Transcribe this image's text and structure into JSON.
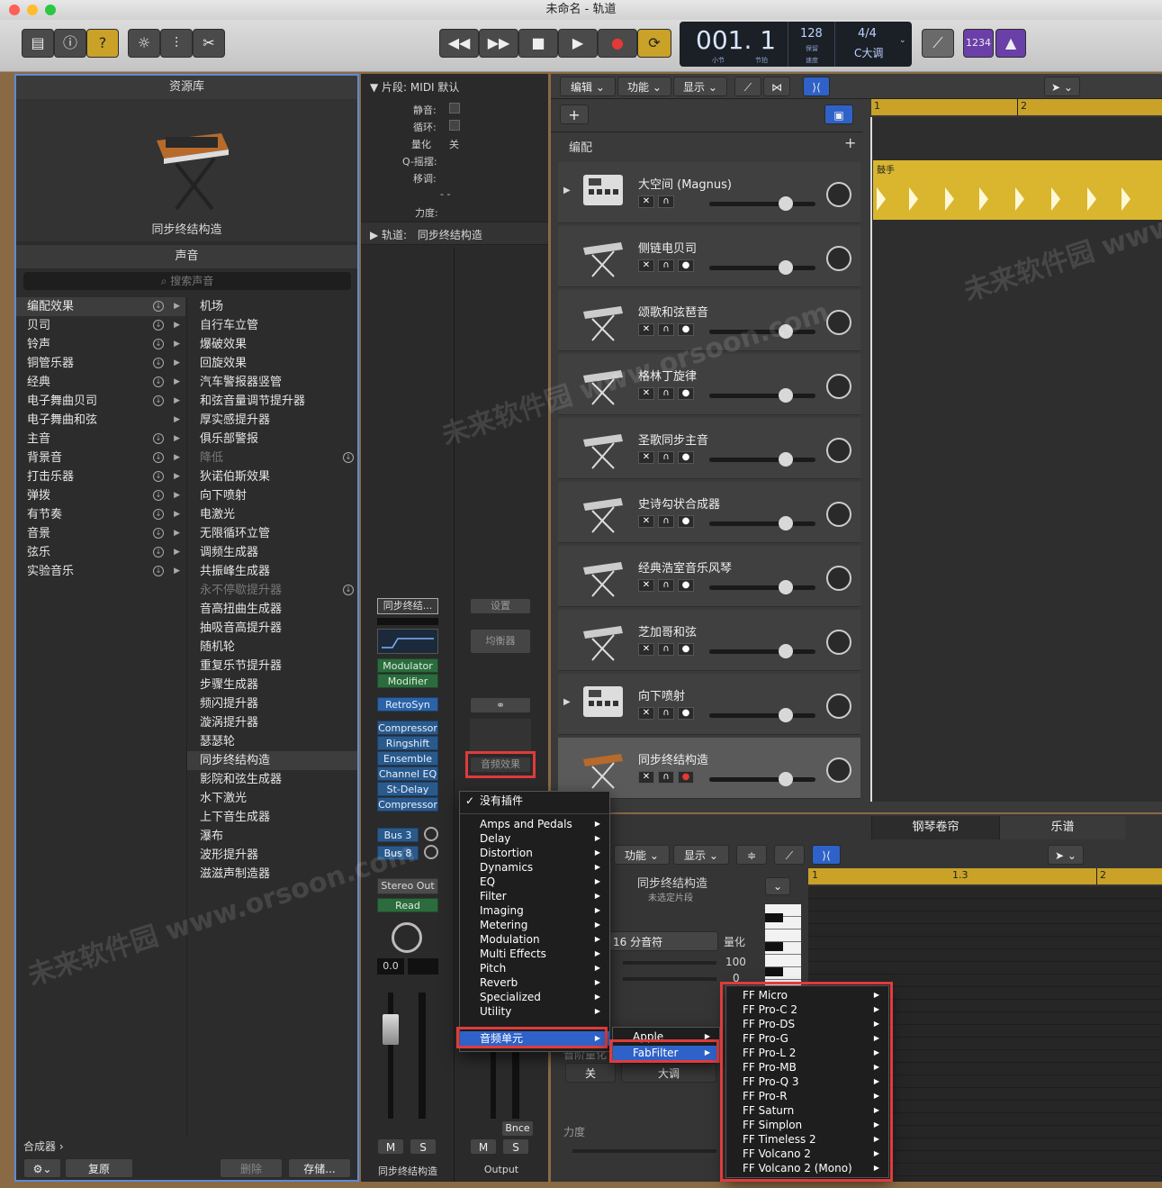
{
  "window": {
    "title": "未命名 - 轨道"
  },
  "toolbar": {
    "buttons": [
      "inbox-icon",
      "info-icon",
      "help-icon",
      "smart-controls-icon",
      "mixer-icon",
      "scissors-icon"
    ],
    "transport": [
      "rewind-icon",
      "forward-icon",
      "stop-icon",
      "play-icon",
      "record-icon",
      "cycle-icon"
    ],
    "lcd": {
      "position": "001. 1",
      "bar_label": "小节",
      "beat_label": "节拍",
      "tempo": "128",
      "tempo_sub": "保留",
      "tempo_label": "速度",
      "signature": "4/4",
      "key": "C大调"
    },
    "count_in": "1234"
  },
  "library": {
    "title": "资源库",
    "patch_name": "同步终结构造",
    "sound_header": "声音",
    "search_placeholder": "搜索声音",
    "categories": [
      "编配效果",
      "贝司",
      "铃声",
      "铜管乐器",
      "经典",
      "电子舞曲贝司",
      "电子舞曲和弦",
      "主音",
      "背景音",
      "打击乐器",
      "弹拨",
      "有节奏",
      "音景",
      "弦乐",
      "实验音乐"
    ],
    "patches": [
      "机场",
      "自行车立管",
      "爆破效果",
      "回旋效果",
      "汽车警报器竖管",
      "和弦音量调节提升器",
      "厚实感提升器",
      "俱乐部警报",
      "降低",
      "狄诺伯斯效果",
      "向下喷射",
      "电激光",
      "无限循环立管",
      "调频生成器",
      "共振峰生成器",
      "永不停歇提升器",
      "音高扭曲生成器",
      "抽吸音高提升器",
      "随机轮",
      "重复乐节提升器",
      "步骤生成器",
      "频闪提升器",
      "漩涡提升器",
      "瑟瑟轮",
      "同步终结构造",
      "影院和弦生成器",
      "水下激光",
      "上下音生成器",
      "瀑布",
      "波形提升器",
      "滋滋声制造器"
    ],
    "footer": {
      "synth_label": "合成器",
      "revert": "复原",
      "delete": "删除",
      "save": "存储..."
    }
  },
  "inspector": {
    "region_header": "片段:",
    "region_name": "MIDI 默认",
    "fields": {
      "mute": "静音:",
      "loop": "循环:",
      "quantize": "量化",
      "quantize_value": "关",
      "qswing": "Q-摇摆:",
      "transpose": "移调:",
      "dashes": "- -",
      "velocity": "力度:"
    },
    "track_header": "轨道:",
    "track_name": "同步终结构造",
    "channel": {
      "name_btn": "同步终结...",
      "settings": "设置",
      "eq": "均衡器",
      "midi_fx": [
        "Modulator",
        "Modifier"
      ],
      "instrument": "RetroSyn",
      "audio_fx": [
        "Compressor",
        "Ringshift",
        "Ensemble",
        "Channel EQ",
        "St-Delay",
        "Compressor"
      ],
      "audio_fx_slot": "音频效果",
      "sends": [
        "Bus 3",
        "Bus 8"
      ],
      "output": "Stereo Out",
      "automation": "Read",
      "volume": "0.0",
      "mute": "M",
      "solo": "S",
      "strip_name": "同步终结构造",
      "bounce": "Bnce",
      "output_name": "Output"
    }
  },
  "tracks_toolbar": {
    "edit": "编辑",
    "functions": "功能",
    "view": "显示",
    "arrangement": "编配"
  },
  "tracks": [
    {
      "name": "大空间 (Magnus)",
      "fader": 0.72
    },
    {
      "name": "侧链电贝司",
      "fader": 0.72
    },
    {
      "name": "颂歌和弦琶音",
      "fader": 0.72
    },
    {
      "name": "格林丁旋律",
      "fader": 0.72
    },
    {
      "name": "圣歌同步主音",
      "fader": 0.72
    },
    {
      "name": "史诗勾状合成器",
      "fader": 0.72
    },
    {
      "name": "经典浩室音乐风琴",
      "fader": 0.72
    },
    {
      "name": "芝加哥和弦",
      "fader": 0.72
    },
    {
      "name": "向下喷射",
      "fader": 0.72
    },
    {
      "name": "同步终结构造",
      "fader": 0.72
    }
  ],
  "ruler": {
    "bar1": "1",
    "bar2": "2"
  },
  "region": {
    "name": "鼓手"
  },
  "editor": {
    "tabs": [
      "钢琴卷帘",
      "乐谱"
    ],
    "functions": "功能",
    "view": "显示",
    "track_name": "同步终结构造",
    "no_region": "未选定片段",
    "quantize_value": "16 分音符",
    "quantize_label": "量化",
    "strength": "100",
    "swing": "0",
    "scale_quantize": "音阶量化",
    "scale_off": "关",
    "scale_key": "大调",
    "velocity": "力度",
    "ruler": [
      "1",
      "1.3",
      "2"
    ]
  },
  "menu_main": {
    "top": "没有插件",
    "items": [
      "Amps and Pedals",
      "Delay",
      "Distortion",
      "Dynamics",
      "EQ",
      "Filter",
      "Imaging",
      "Metering",
      "Modulation",
      "Multi Effects",
      "Pitch",
      "Reverb",
      "Specialized",
      "Utility"
    ],
    "audio_units": "音频单元"
  },
  "menu_vendor": {
    "items": [
      "Apple",
      "FabFilter"
    ]
  },
  "menu_fabfilter": {
    "items": [
      "FF Micro",
      "FF Pro-C 2",
      "FF Pro-DS",
      "FF Pro-G",
      "FF Pro-L 2",
      "FF Pro-MB",
      "FF Pro-Q 3",
      "FF Pro-R",
      "FF Saturn",
      "FF Simplon",
      "FF Timeless 2",
      "FF Volcano 2",
      "FF Volcano 2 (Mono)"
    ]
  },
  "colors": {
    "accent": "#c9a227",
    "highlight": "#2f62c8",
    "callout": "#e03b3b",
    "selection_border": "#5b8bd8"
  }
}
